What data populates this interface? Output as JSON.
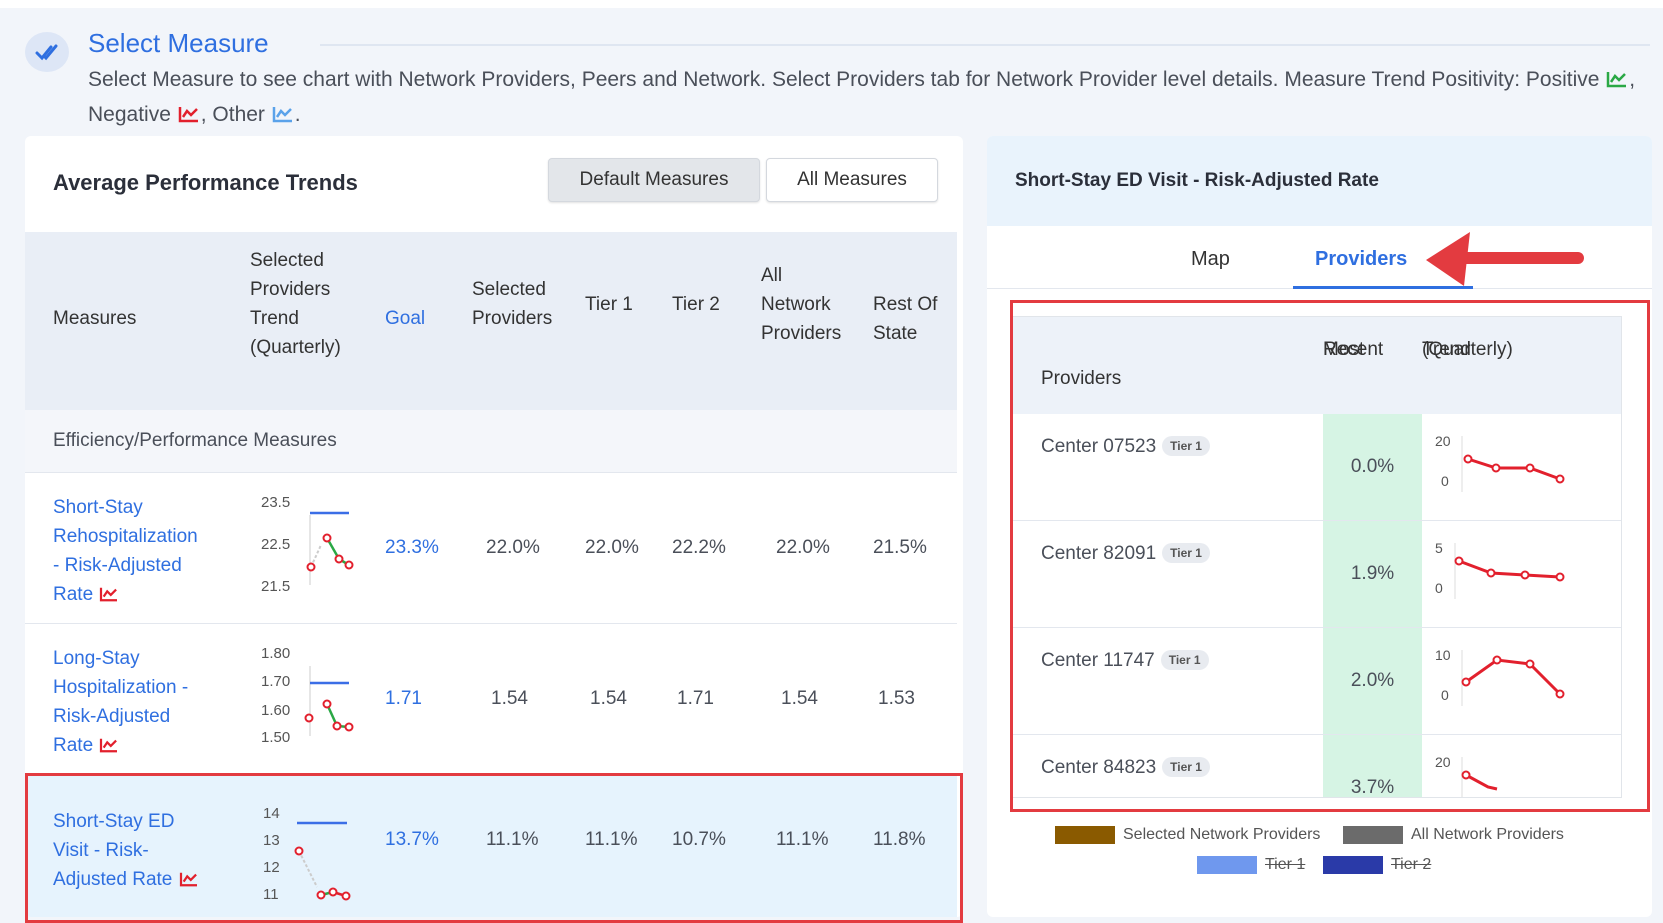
{
  "header": {
    "title": "Select Measure",
    "description_part1": "Select Measure to see chart with Network Providers, Peers and Network. Select Providers tab for Network Provider level details. Measure Trend Positivity: Positive",
    "positive_sep": ", Negative",
    "negative_sep": ", Other",
    "end": "."
  },
  "colors": {
    "positive": "#2aa845",
    "negative": "#e2202d",
    "other": "#5aa2ea",
    "accent": "#2f6fe0",
    "highlight": "#e33b40"
  },
  "left_panel": {
    "title": "Average Performance Trends",
    "buttons": {
      "default": "Default Measures",
      "all": "All Measures"
    },
    "columns": {
      "measures": "Measures",
      "trend": [
        "Selected",
        "Providers",
        "Trend",
        "(Quarterly)"
      ],
      "goal": "Goal",
      "selected": [
        "Selected",
        "Providers"
      ],
      "tier1": "Tier 1",
      "tier2": "Tier 2",
      "all_network": [
        "All",
        "Network",
        "Providers"
      ],
      "rest_of_state": [
        "Rest Of",
        "State"
      ]
    },
    "section": "Efficiency/Performance Measures",
    "rows": [
      {
        "name": [
          "Short-Stay",
          "Rehospitalization",
          "- Risk-Adjusted",
          "Rate"
        ],
        "ticks": [
          "23.5",
          "22.5",
          "21.5"
        ],
        "goal": "23.3%",
        "selected": "22.0%",
        "tier1": "22.0%",
        "tier2": "22.2%",
        "all_network": "22.0%",
        "rest_of_state": "21.5%"
      },
      {
        "name": [
          "Long-Stay",
          "Hospitalization -",
          "Risk-Adjusted",
          "Rate"
        ],
        "ticks": [
          "1.80",
          "1.70",
          "1.60",
          "1.50"
        ],
        "goal": "1.71",
        "selected": "1.54",
        "tier1": "1.54",
        "tier2": "1.71",
        "all_network": "1.54",
        "rest_of_state": "1.53"
      },
      {
        "name": [
          "Short-Stay ED",
          "Visit - Risk-",
          "Adjusted Rate"
        ],
        "ticks": [
          "14",
          "13",
          "12",
          "11"
        ],
        "goal": "13.7%",
        "selected": "11.1%",
        "tier1": "11.1%",
        "tier2": "10.7%",
        "all_network": "11.1%",
        "rest_of_state": "11.8%"
      }
    ]
  },
  "right_panel": {
    "title": "Short-Stay ED Visit - Risk-Adjusted Rate",
    "tabs": {
      "map": "Map",
      "providers": "Providers"
    },
    "columns": {
      "providers": "Providers",
      "most_recent": [
        "Most",
        "Recent"
      ],
      "trend": [
        "Trend",
        "(Quarterly)"
      ]
    },
    "rows": [
      {
        "name": "Center 07523",
        "tier": "Tier 1",
        "recent": "0.0%",
        "ticks": [
          "20",
          "0"
        ]
      },
      {
        "name": "Center 82091",
        "tier": "Tier 1",
        "recent": "1.9%",
        "ticks": [
          "5",
          "0"
        ]
      },
      {
        "name": "Center 11747",
        "tier": "Tier 1",
        "recent": "2.0%",
        "ticks": [
          "10",
          "0"
        ]
      },
      {
        "name": "Center 84823",
        "tier": "Tier 1",
        "recent": "3.7%",
        "ticks": [
          "20",
          ""
        ]
      }
    ],
    "legend": {
      "selected": "Selected Network Providers",
      "all": "All Network Providers",
      "tier1": "Tier 1",
      "tier2": "Tier 2",
      "colors": {
        "selected": "#8a5a00",
        "all": "#6b6b6b",
        "tier1": "#6f98ee",
        "tier2": "#2a3aa8"
      }
    }
  }
}
